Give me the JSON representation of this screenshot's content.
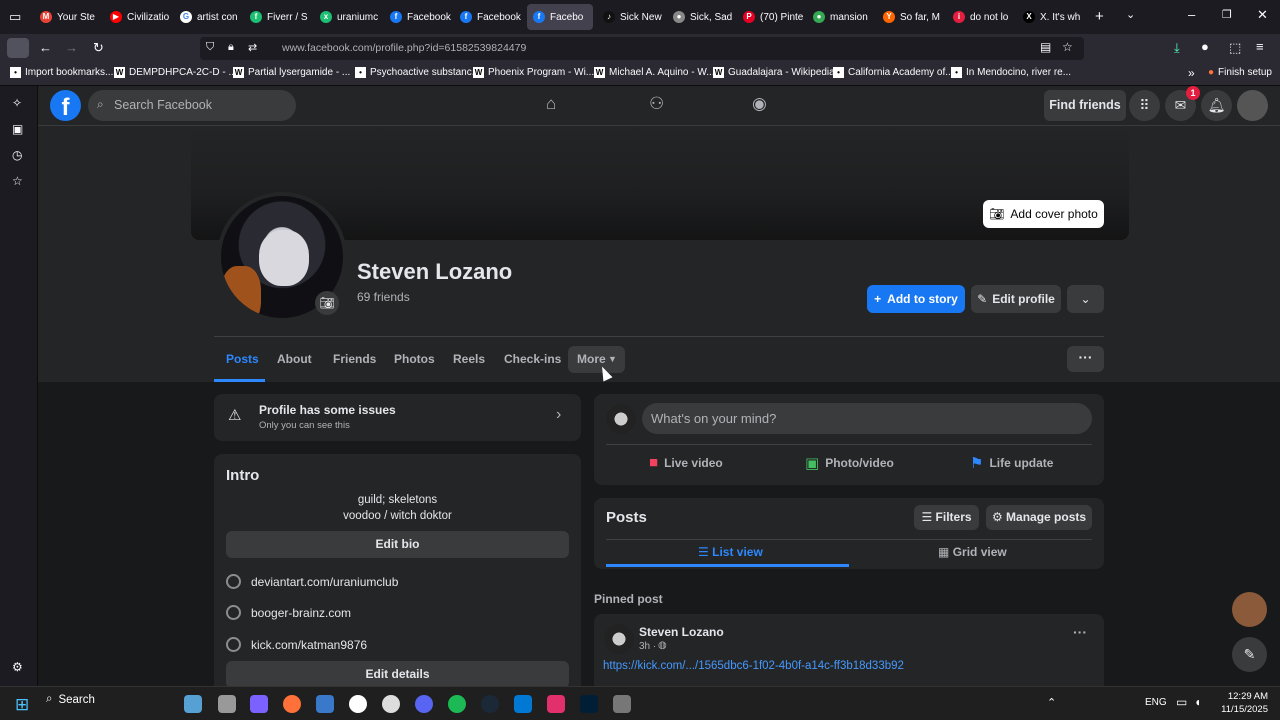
{
  "browser": {
    "tabs": [
      {
        "label": "Your Ste",
        "favicon": "gmail-icon",
        "color": "#ea4335",
        "glyph": "M"
      },
      {
        "label": "Civilizatio",
        "favicon": "youtube-icon",
        "color": "#ff0000",
        "glyph": "▶"
      },
      {
        "label": "artist con",
        "favicon": "google-icon",
        "color": "#ffffff",
        "glyph": "G"
      },
      {
        "label": "Fiverr / S",
        "favicon": "fiverr-icon",
        "color": "#1dbf73",
        "glyph": "f"
      },
      {
        "label": "uraniumc",
        "favicon": "x-icon",
        "color": "#1dbf73",
        "glyph": "x"
      },
      {
        "label": "Facebook",
        "favicon": "facebook-icon",
        "color": "#1877f2",
        "glyph": "f"
      },
      {
        "label": "Facebook",
        "favicon": "facebook-icon",
        "color": "#1877f2",
        "glyph": "f"
      },
      {
        "label": "Facebo",
        "favicon": "facebook-icon",
        "color": "#1877f2",
        "glyph": "f",
        "active": true
      },
      {
        "label": "Sick New",
        "favicon": "tiktok-icon",
        "color": "#111111",
        "glyph": "♪"
      },
      {
        "label": "Sick, Sad",
        "favicon": "reddit-icon",
        "color": "#888888",
        "glyph": "●"
      },
      {
        "label": "(70) Pinte",
        "favicon": "pinterest-icon",
        "color": "#e60023",
        "glyph": "P"
      },
      {
        "label": "mansion",
        "favicon": "maps-icon",
        "color": "#34a853",
        "glyph": "●"
      },
      {
        "label": "So far, M",
        "favicon": "ycombinator-icon",
        "color": "#ff6600",
        "glyph": "Y"
      },
      {
        "label": "do not lo",
        "favicon": "page-icon",
        "color": "#e41e3f",
        "glyph": "i"
      },
      {
        "label": "X. It's wh",
        "favicon": "x-logo-icon",
        "color": "#000000",
        "glyph": "X"
      }
    ],
    "url": "www.facebook.com/profile.php?id=61582539824479",
    "bookmarks": [
      {
        "label": "Import bookmarks...",
        "icon": "import-icon"
      },
      {
        "label": "DEMPDHPCA-2C-D - ...",
        "icon": "wikipedia-icon"
      },
      {
        "label": "Partial lysergamide - ...",
        "icon": "wikipedia-icon"
      },
      {
        "label": "Psychoactive substanc...",
        "icon": "page-icon"
      },
      {
        "label": "Phoenix Program - Wi...",
        "icon": "wikipedia-icon"
      },
      {
        "label": "Michael A. Aquino - W...",
        "icon": "wikipedia-icon"
      },
      {
        "label": "Guadalajara - Wikipedia",
        "icon": "wikipedia-icon"
      },
      {
        "label": "California Academy of...",
        "icon": "page-icon"
      },
      {
        "label": "In Mendocino, river re...",
        "icon": "news-icon"
      }
    ],
    "finish_setup": "Finish setup"
  },
  "facebook": {
    "search_placeholder": "Search Facebook",
    "find_friends": "Find friends",
    "notification_count": "1",
    "add_cover_photo": "Add cover photo",
    "profile_name": "Steven Lozano",
    "friends_count": "69 friends",
    "add_to_story": "Add to story",
    "edit_profile": "Edit profile",
    "tabs": [
      "Posts",
      "About",
      "Friends",
      "Photos",
      "Reels",
      "Check-ins",
      "More"
    ],
    "issues_title": "Profile has some issues",
    "issues_subtitle": "Only you can see this",
    "intro_title": "Intro",
    "bio_line1": "guild; skeletons",
    "bio_line2": "voodoo / witch doktor",
    "edit_bio": "Edit bio",
    "links": [
      "deviantart.com/uraniumclub",
      "booger-brainz.com",
      "kick.com/katman9876"
    ],
    "edit_details": "Edit details",
    "composer_placeholder": "What's on your mind?",
    "composer_actions": [
      {
        "label": "Live video",
        "icon": "live-video-icon",
        "color": "#f3425f"
      },
      {
        "label": "Photo/video",
        "icon": "photo-icon",
        "color": "#45bd62"
      },
      {
        "label": "Life update",
        "icon": "flag-icon",
        "color": "#2d88ff"
      }
    ],
    "posts_title": "Posts",
    "filters": "Filters",
    "manage_posts": "Manage posts",
    "list_view": "List view",
    "grid_view": "Grid view",
    "pinned_post": "Pinned post",
    "post_author": "Steven Lozano",
    "post_time": "3h ·",
    "post_link": "https://kick.com/.../1565dbc6-1f02-4b0f-a14c-ff3b18d33b92"
  },
  "taskbar": {
    "search": "Search",
    "language": "ENG",
    "time": "12:29 AM",
    "date": "11/15/2025"
  }
}
